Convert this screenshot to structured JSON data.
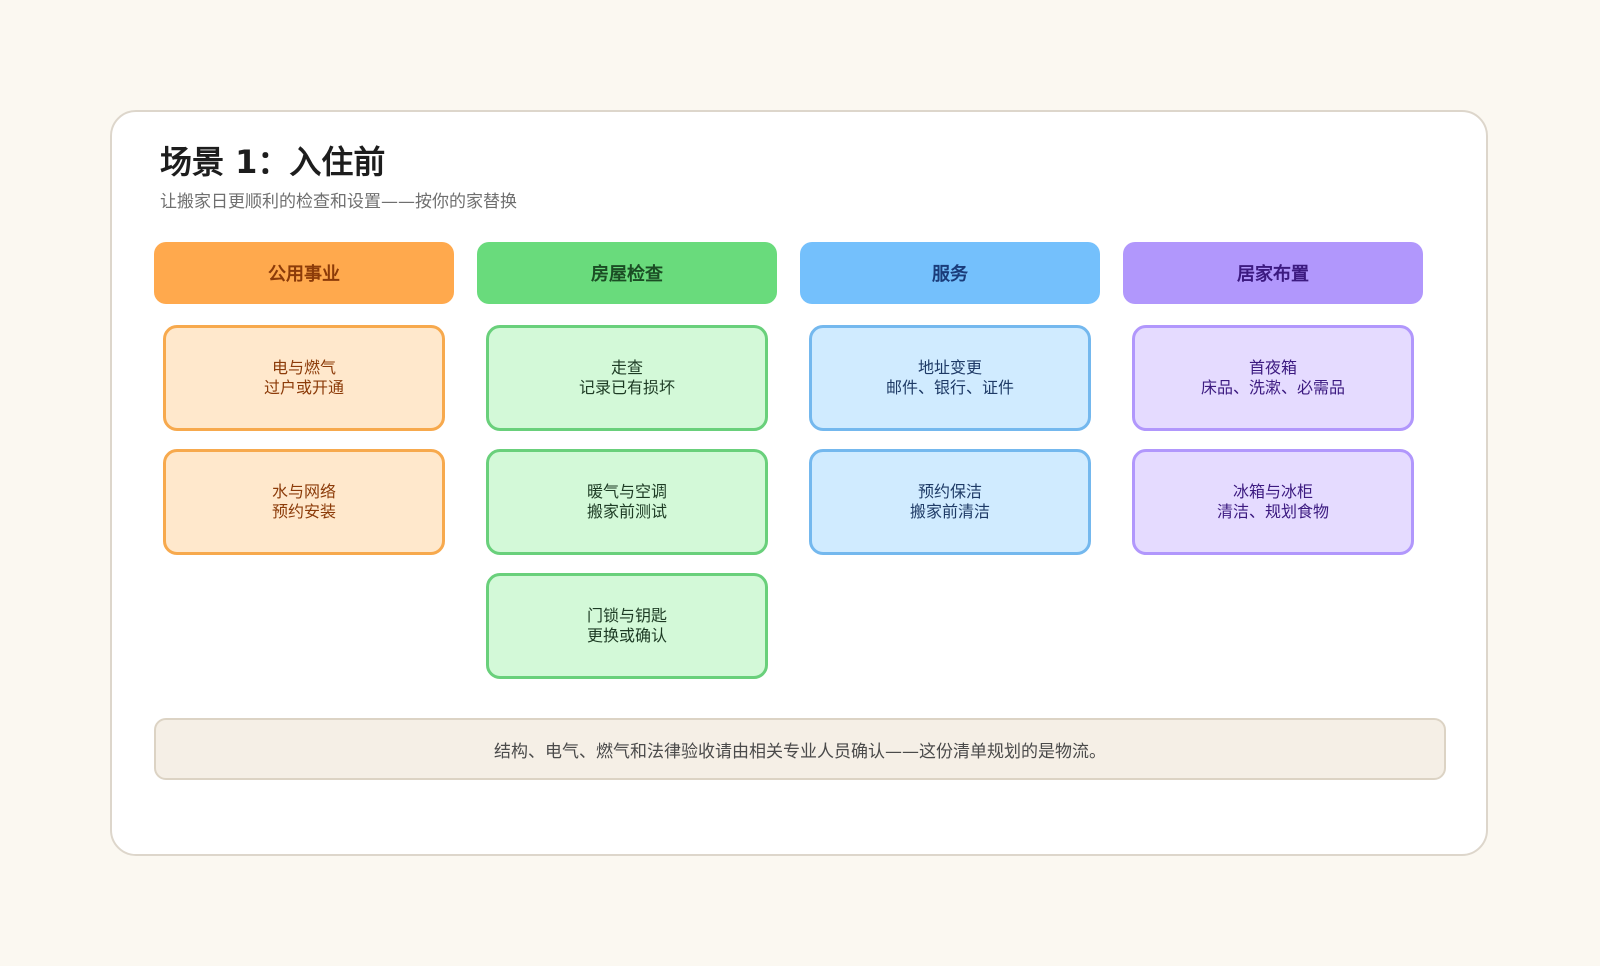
{
  "title": "场景 1：入住前",
  "subtitle": "让搬家日更顺利的检查和设置——按你的家替换",
  "columns": [
    {
      "header": "公用事业",
      "color": "#ffa94d",
      "items": [
        {
          "line1": "电与燃气",
          "line2": "过户或开通"
        },
        {
          "line1": "水与网络",
          "line2": "预约安装"
        }
      ]
    },
    {
      "header": "房屋检查",
      "color": "#69db7c",
      "items": [
        {
          "line1": "走查",
          "line2": "记录已有损坏"
        },
        {
          "line1": "暖气与空调",
          "line2": "搬家前测试"
        },
        {
          "line1": "门锁与钥匙",
          "line2": "更换或确认"
        }
      ]
    },
    {
      "header": "服务",
      "color": "#74c0fc",
      "items": [
        {
          "line1": "地址变更",
          "line2": "邮件、银行、证件"
        },
        {
          "line1": "预约保洁",
          "line2": "搬家前清洁"
        }
      ]
    },
    {
      "header": "居家布置",
      "color": "#b197fc",
      "items": [
        {
          "line1": "首夜箱",
          "line2": "床品、洗漱、必需品"
        },
        {
          "line1": "冰箱与冰柜",
          "line2": "清洁、规划食物"
        }
      ]
    }
  ],
  "note": "结构、电气、燃气和法律验收请由相关专业人员确认——这份清单规划的是物流。"
}
